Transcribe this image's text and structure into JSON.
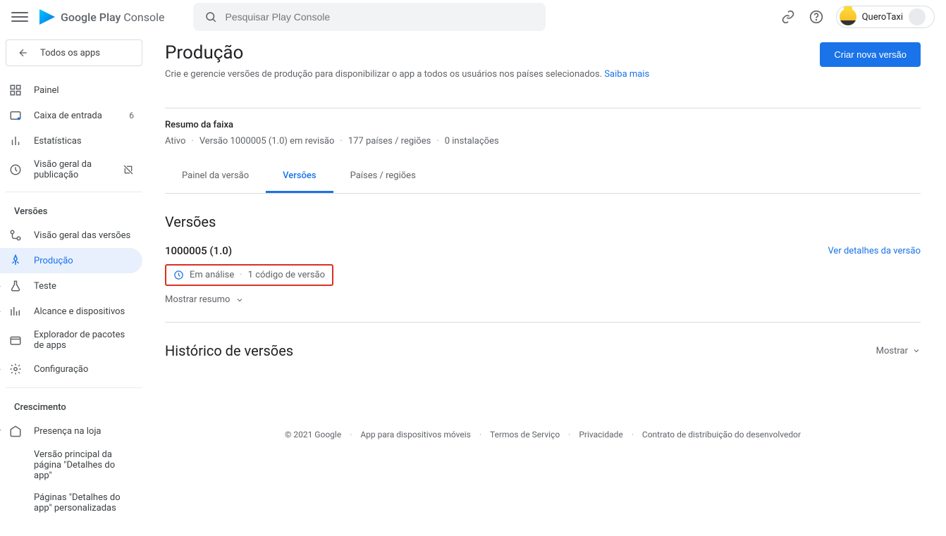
{
  "header": {
    "logo_text_bold": "Google Play",
    "logo_text_light": "Console",
    "search_placeholder": "Pesquisar Play Console",
    "user_name": "QueroTaxi"
  },
  "sidebar": {
    "back_label": "Todos os apps",
    "items": {
      "painel": "Painel",
      "inbox": "Caixa de entrada",
      "inbox_badge": "6",
      "stats": "Estatísticas",
      "pub_overview": "Visão geral da publicação"
    },
    "section_versoes": "Versões",
    "items2": {
      "ver_overview": "Visão geral das versões",
      "producao": "Produção",
      "teste": "Teste",
      "alcance": "Alcance e dispositivos",
      "explorador": "Explorador de pacotes de apps",
      "config": "Configuração"
    },
    "section_cresc": "Crescimento",
    "items3": {
      "presenca": "Presença na loja",
      "versao_principal": "Versão principal da página \"Detalhes do app\"",
      "paginas_pers": "Páginas \"Detalhes do app\" personalizadas"
    }
  },
  "page": {
    "title": "Produção",
    "subtitle": "Crie e gerencie versões de produção para disponibilizar o app a todos os usuários nos países selecionados.",
    "learn_more": "Saiba mais",
    "create_btn": "Criar nova versão",
    "summary_label": "Resumo da faixa",
    "summary": {
      "status": "Ativo",
      "version": "Versão 1000005 (1.0) em revisão",
      "countries": "177 países / regiões",
      "installs": "0 instalações"
    },
    "tabs": {
      "panel": "Painel da versão",
      "versoes": "Versões",
      "paises": "Países / regiões"
    },
    "section_versoes": "Versões",
    "version_item": {
      "title": "1000005 (1.0)",
      "detail_link": "Ver detalhes da versão",
      "status": "Em análise",
      "code": "1 código de versão",
      "show_summary": "Mostrar resumo"
    },
    "section_history": "Histórico de versões",
    "show_btn": "Mostrar"
  },
  "footer": {
    "copyright": "© 2021 Google",
    "mobile": "App para dispositivos móveis",
    "terms": "Termos de Serviço",
    "privacy": "Privacidade",
    "dist": "Contrato de distribuição do desenvolvedor"
  }
}
